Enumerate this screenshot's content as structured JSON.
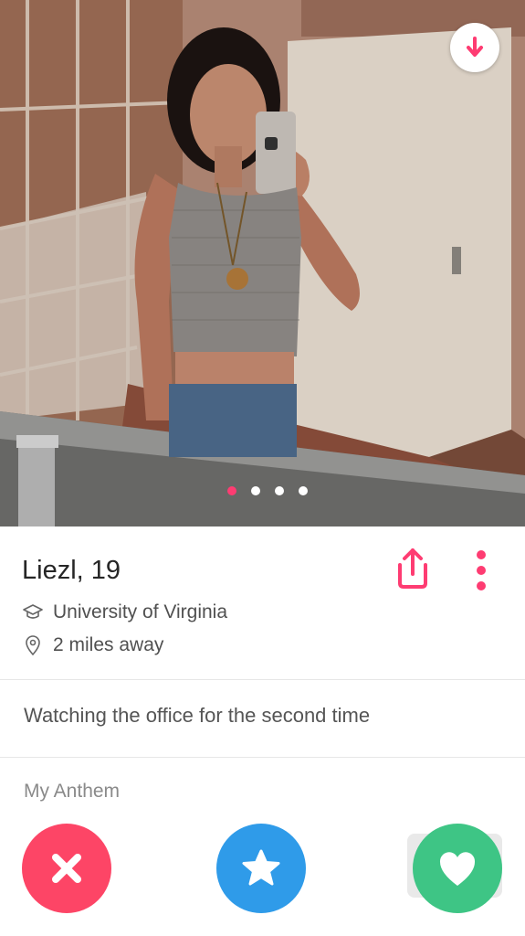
{
  "profile": {
    "name": "Liezl",
    "age_sep": ", ",
    "age": "19",
    "school": "University of Virginia",
    "distance": "2 miles away",
    "bio": "Watching the office for the second time",
    "anthem_title": "My Anthem"
  },
  "photo": {
    "count": 4,
    "active_index": 0,
    "description_icon": "photo"
  },
  "colors": {
    "brand": "#fe3c72",
    "nope": "#fd4566",
    "super_like": "#2f9be9",
    "like": "#3ec585"
  },
  "icons": {
    "collapse": "arrow-down-icon",
    "share": "share-icon",
    "more": "more-vertical-icon",
    "school": "graduation-cap-icon",
    "location": "location-pin-icon",
    "nope": "close-icon",
    "super_like": "star-icon",
    "like": "heart-icon"
  }
}
